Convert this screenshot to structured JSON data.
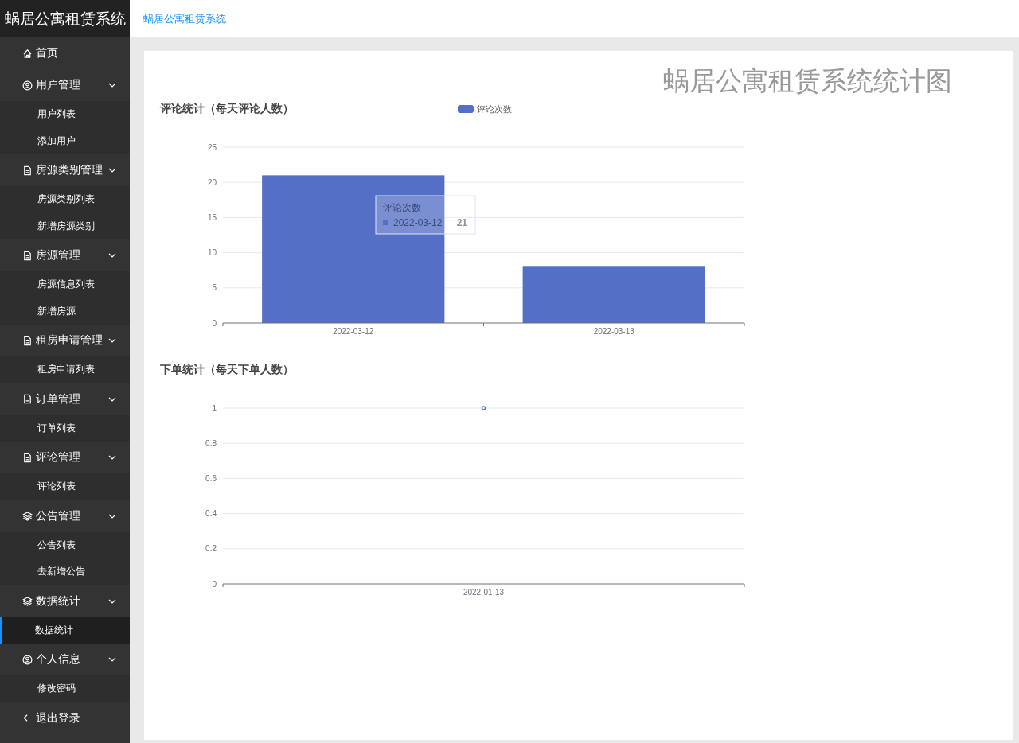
{
  "brand": "蜗居公寓租赁系统",
  "breadcrumb": "蜗居公寓租赁系统",
  "sidebar": {
    "items": [
      {
        "label": "首页",
        "kind": "home"
      },
      {
        "label": "用户管理",
        "kind": "user",
        "expanded": true,
        "children": [
          {
            "label": "用户列表",
            "selected": false
          },
          {
            "label": "添加用户",
            "selected": false
          }
        ]
      },
      {
        "label": "房源类别管理",
        "kind": "document",
        "expanded": true,
        "children": [
          {
            "label": "房源类别列表",
            "selected": false
          },
          {
            "label": "新增房源类别",
            "selected": false
          }
        ]
      },
      {
        "label": "房源管理",
        "kind": "document",
        "expanded": true,
        "children": [
          {
            "label": "房源信息列表",
            "selected": false
          },
          {
            "label": "新增房源",
            "selected": false
          }
        ]
      },
      {
        "label": "租房申请管理",
        "kind": "document",
        "expanded": true,
        "children": [
          {
            "label": "租房申请列表",
            "selected": false
          }
        ]
      },
      {
        "label": "订单管理",
        "kind": "document",
        "expanded": true,
        "children": [
          {
            "label": "订单列表",
            "selected": false
          }
        ]
      },
      {
        "label": "评论管理",
        "kind": "document",
        "expanded": true,
        "children": [
          {
            "label": "评论列表",
            "selected": false
          }
        ]
      },
      {
        "label": "公告管理",
        "kind": "stack",
        "expanded": true,
        "children": [
          {
            "label": "公告列表",
            "selected": false
          },
          {
            "label": "去新增公告",
            "selected": false
          }
        ]
      },
      {
        "label": "数据统计",
        "kind": "stack",
        "expanded": true,
        "children": [
          {
            "label": "数据统计",
            "selected": true
          }
        ]
      },
      {
        "label": "个人信息",
        "kind": "user",
        "expanded": true,
        "children": [
          {
            "label": "修改密码",
            "selected": false
          }
        ]
      },
      {
        "label": "退出登录",
        "kind": "logout"
      }
    ]
  },
  "page_title": "蜗居公寓租赁系统统计图",
  "charts": [
    {
      "chart_data": {
        "type": "bar",
        "title": "评论统计（每天评论人数）",
        "categories": [
          "2022-03-12",
          "2022-03-13"
        ],
        "series": [
          {
            "name": "评论次数",
            "color": "#5470c6",
            "values": [
              21,
              8
            ]
          }
        ],
        "grid": true,
        "ylim": [
          0,
          25
        ],
        "yticks": [
          0,
          5,
          10,
          15,
          20,
          25
        ]
      },
      "tooltip": {
        "title": "评论次数",
        "label": "2022-03-12",
        "value": "21"
      }
    },
    {
      "chart_data": {
        "type": "line",
        "title": "下单统计（每天下单人数）",
        "categories": [
          "2022-01-13"
        ],
        "series": [
          {
            "color": "#5470c6",
            "values": [
              1
            ],
            "marker": true
          }
        ],
        "grid": true,
        "ylim": [
          0,
          1
        ],
        "yticks": [
          {
            "value": 0,
            "label": "0"
          },
          {
            "value": 0.2,
            "label": "0.2"
          },
          {
            "value": 0.4,
            "label": "0.4"
          },
          {
            "value": 0.6,
            "label": "0.6"
          },
          {
            "value": 0.8,
            "label": "0.8"
          },
          {
            "value": 1,
            "label": "1"
          }
        ]
      }
    }
  ]
}
